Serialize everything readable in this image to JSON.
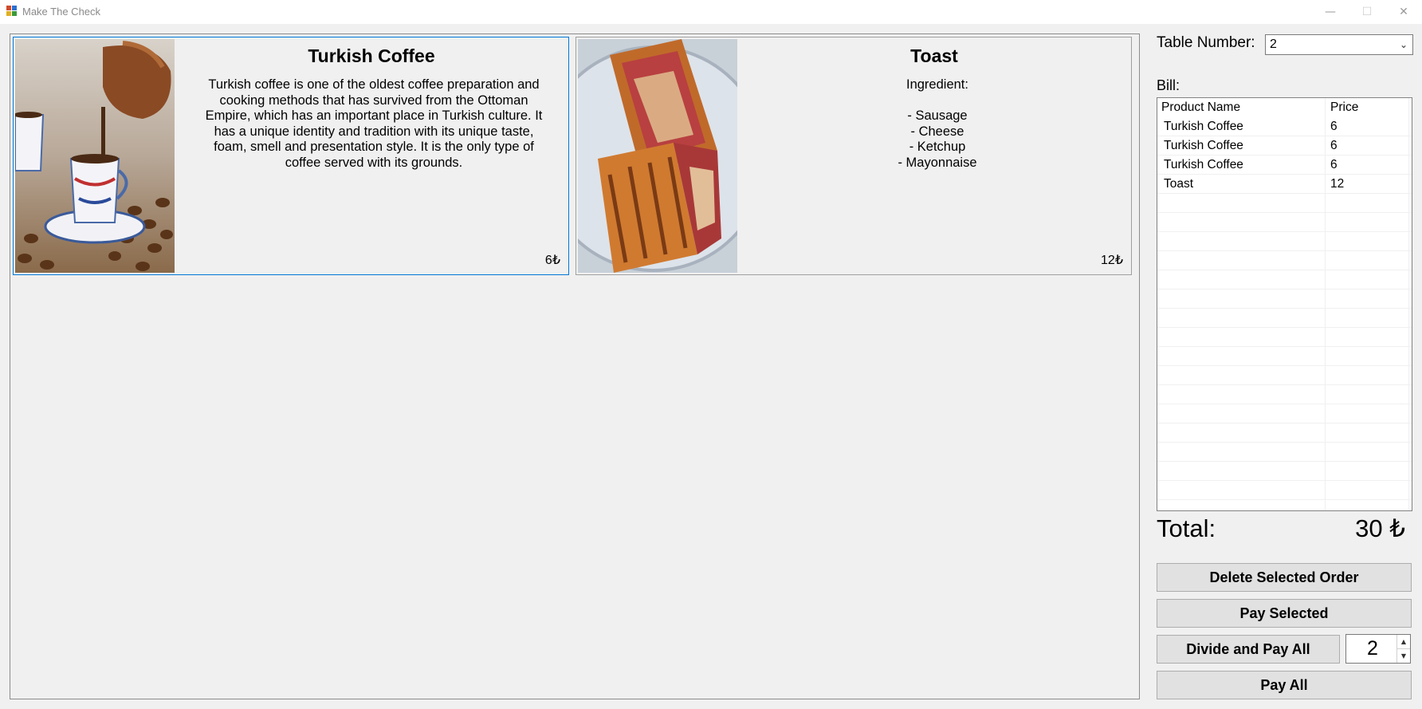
{
  "window": {
    "title": "Make The Check",
    "minimize": "—",
    "maximize": "☐",
    "close": "✕"
  },
  "menu": {
    "items": [
      {
        "title": "Turkish Coffee",
        "description": "Turkish coffee is one of the oldest coffee preparation and cooking methods that has survived from the Ottoman Empire, which has an important place in Turkish culture. It has a unique identity and tradition with its unique taste, foam, smell and presentation style. It is the only type of coffee served with its grounds.",
        "price": "6₺"
      },
      {
        "title": "Toast",
        "description": "Ingredient:\n\n- Sausage\n- Cheese\n- Ketchup\n- Mayonnaise",
        "price": "12₺"
      }
    ]
  },
  "sidebar": {
    "table_label": "Table Number:",
    "table_value": "2",
    "bill_label": "Bill:",
    "bill_columns": [
      "Product Name",
      "Price"
    ],
    "bill_rows": [
      {
        "name": "Turkish Coffee",
        "price": "6"
      },
      {
        "name": "Turkish Coffee",
        "price": "6"
      },
      {
        "name": "Turkish Coffee",
        "price": "6"
      },
      {
        "name": "Toast",
        "price": "12"
      }
    ],
    "total_label": "Total:",
    "total_value": "30 ₺",
    "buttons": {
      "delete": "Delete Selected Order",
      "pay_selected": "Pay Selected",
      "divide": "Divide and Pay All",
      "pay_all": "Pay All"
    },
    "divide_count": "2"
  }
}
